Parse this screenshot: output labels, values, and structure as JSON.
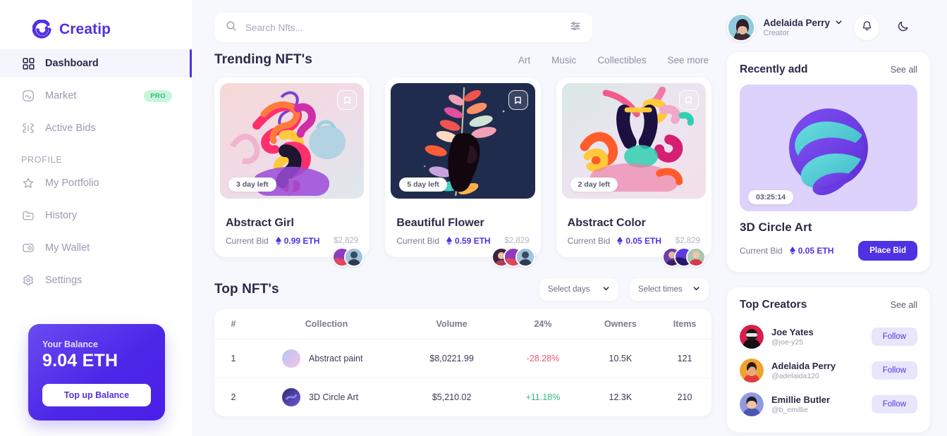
{
  "brand": {
    "name": "Creatip",
    "accent": "#4f32e3"
  },
  "sidebar": {
    "items": [
      {
        "label": "Dashboard",
        "icon": "grid-icon",
        "active": true
      },
      {
        "label": "Market",
        "icon": "market-icon",
        "badge": "PRO"
      },
      {
        "label": "Active Bids",
        "icon": "bids-icon"
      }
    ],
    "section_label": "PROFILE",
    "profile_items": [
      {
        "label": "My Portfolio",
        "icon": "star-icon"
      },
      {
        "label": "History",
        "icon": "history-icon"
      },
      {
        "label": "My Wallet",
        "icon": "wallet-icon"
      },
      {
        "label": "Settings",
        "icon": "gear-icon"
      }
    ],
    "balance": {
      "label": "Your Balance",
      "value": "9.04 ETH",
      "button": "Top up Balance"
    }
  },
  "header": {
    "search_placeholder": "Search Nfts...",
    "search_value": "",
    "user": {
      "name": "Adelaida Perry",
      "role": "Creator"
    },
    "notification_icon": "bell-icon",
    "theme_icon": "moon-icon",
    "filter_icon": "sliders-icon",
    "search_icon": "search-icon",
    "chevron_icon": "chevron-down-icon"
  },
  "trending": {
    "title": "Trending NFT's",
    "tabs": [
      "Art",
      "Music",
      "Collectibles",
      "See more"
    ],
    "cards": [
      {
        "name": "Abstract Girl",
        "time_left": "3 day left",
        "bid_label": "Current Bid",
        "bid_eth": "0.99 ETH",
        "bid_usd": "$2,829",
        "bidder_count": 2
      },
      {
        "name": "Beautiful Flower",
        "time_left": "5 day left",
        "bid_label": "Current Bid",
        "bid_eth": "0.59 ETH",
        "bid_usd": "$2,829",
        "bidder_count": 3
      },
      {
        "name": "Abstract Color",
        "time_left": "2 day left",
        "bid_label": "Current Bid",
        "bid_eth": "0.05 ETH",
        "bid_usd": "$2,829",
        "bidder_count": 3
      }
    ]
  },
  "top_nfts": {
    "title": "Top NFT's",
    "select_days": "Select days",
    "select_times": "Select times",
    "columns": [
      "#",
      "Collection",
      "Volume",
      "24%",
      "Owners",
      "Items"
    ],
    "rows": [
      {
        "rank": "1",
        "collection": "Abstract paint",
        "volume": "$8,0221.99",
        "change": "-28.28%",
        "change_dir": "down",
        "owners": "10.5K",
        "items": "121"
      },
      {
        "rank": "2",
        "collection": "3D Circle Art",
        "volume": "$5,210.02",
        "change": "+11.18%",
        "change_dir": "up",
        "owners": "12.3K",
        "items": "210"
      }
    ]
  },
  "recently_add": {
    "title": "Recently add",
    "see_all": "See all",
    "timer": "03:25:14",
    "name": "3D Circle Art",
    "bid_label": "Current Bid",
    "bid_eth": "0.05 ETH",
    "button": "Place Bid"
  },
  "top_creators": {
    "title": "Top Creators",
    "see_all": "See all",
    "follow_label": "Follow",
    "creators": [
      {
        "name": "Joe Yates",
        "handle": "@joe-y25"
      },
      {
        "name": "Adelaida Perry",
        "handle": "@adelaida120"
      },
      {
        "name": "Emillie Butler",
        "handle": "@b_emillie"
      }
    ]
  }
}
